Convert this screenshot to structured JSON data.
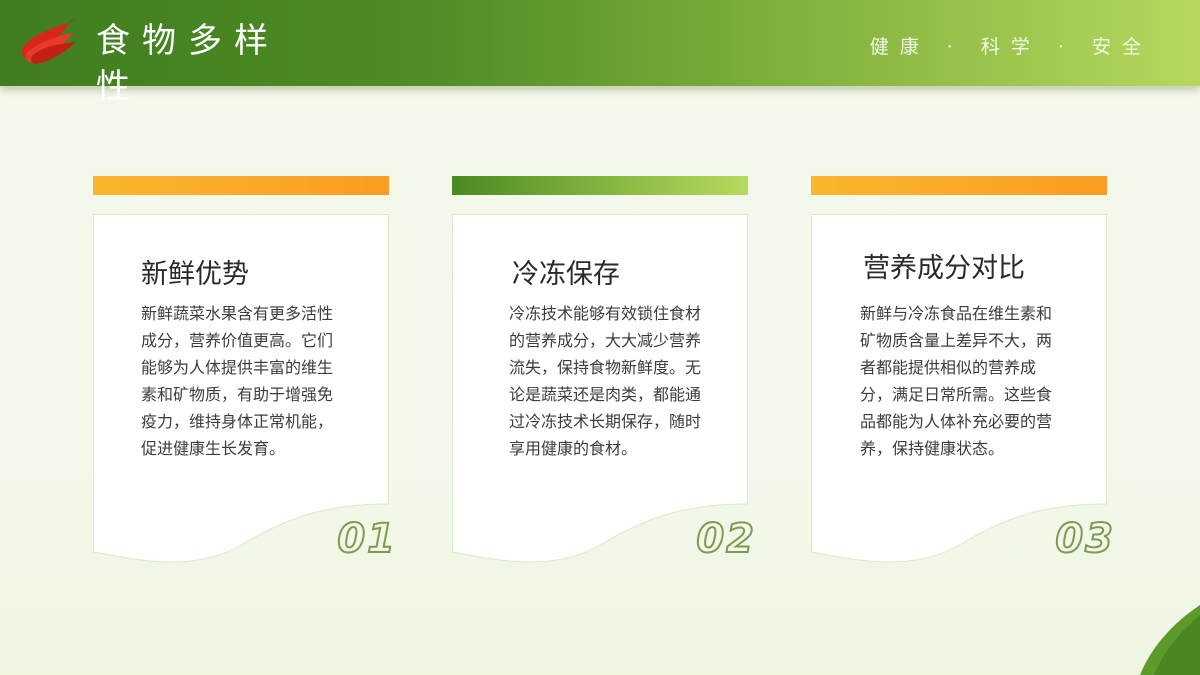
{
  "header": {
    "title": "食物多样性",
    "tagline": "健康 · 科学 · 安全"
  },
  "cards": [
    {
      "heading": "新鲜优势",
      "text": "新鲜蔬菜水果含有更多活性成分，营养价值更高。它们能够为人体提供丰富的维生素和矿物质，有助于增强免疫力，维持身体正常机能，促进健康生长发育。",
      "number": "01",
      "bar_style": "orange"
    },
    {
      "heading": "冷冻保存",
      "text": "冷冻技术能够有效锁住食材的营养成分，大大减少营养流失，保持食物新鲜度。无论是蔬菜还是肉类，都能通过冷冻技术长期保存，随时享用健康的食材。",
      "number": "02",
      "bar_style": "green"
    },
    {
      "heading": "营养成分对比",
      "text": "新鲜与冷冻食品在维生素和矿物质含量上差异不大，两者都能提供相似的营养成分，满足日常所需。这些食品都能为人体补充必要的营养，保持健康状态。",
      "number": "03",
      "bar_style": "orange"
    }
  ],
  "colors": {
    "header_dark": "#3f7d1f",
    "header_light": "#b6d85e",
    "accent_orange": "#fb9b23",
    "number_stroke": "#7f9a4f"
  }
}
